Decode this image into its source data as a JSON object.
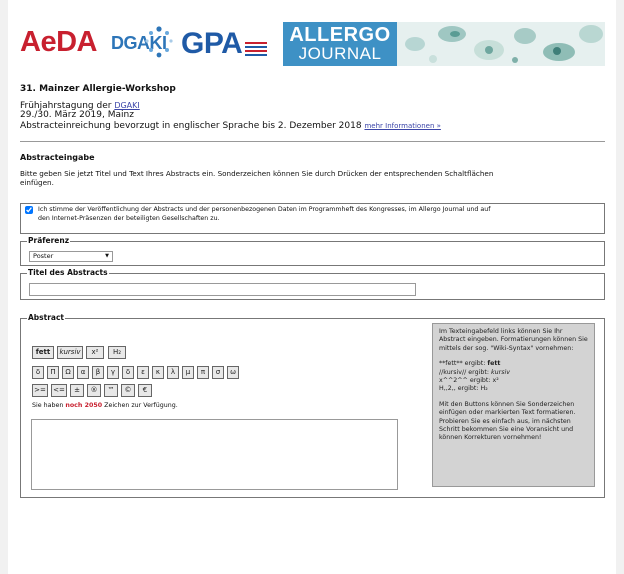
{
  "banner": {
    "aeda": "AeDA",
    "dgaki": "DGAKI",
    "gpa": "GPA",
    "allergo_line1": "ALLERGO",
    "allergo_line2": "JOURNAL"
  },
  "event": {
    "title": "31. Mainzer Allergie-Workshop",
    "line1_prefix": "Frühjahrstagung der",
    "line1_link": "DGAKI",
    "line2": "29./30. März 2019, Mainz",
    "line3": "Abstracteinreichung bevorzugt in englischer Sprache bis 2. Dezember 2018",
    "more_info_link": "mehr Informationen »"
  },
  "section": {
    "heading": "Abstracteingabe",
    "intro_line1": "Bitte geben Sie jetzt Titel und Text Ihres Abstracts ein. Sonderzeichen können Sie durch Drücken der entsprechenden Schaltflächen",
    "intro_line2": "einfügen."
  },
  "consent": {
    "checked": true,
    "line1": "Ich stimme der Veröffentlichung der Abstracts und der personenbezogenen Daten im Programmheft des Kongresses, im Allergo Journal und auf",
    "line2": "den Internet-Präsenzen der beteiligten Gesellschaften zu."
  },
  "preferenz": {
    "legend": "Präferenz",
    "selected": "Poster"
  },
  "titel": {
    "legend": "Titel des Abstracts",
    "value": ""
  },
  "abstract": {
    "legend": "Abstract",
    "format_buttons": [
      "fett",
      "kursiv",
      "x²",
      "H₂"
    ],
    "greek_buttons": [
      "δ",
      "Π",
      "Ω",
      "α",
      "β",
      "γ",
      "δ",
      "ε",
      "κ",
      "λ",
      "μ",
      "π",
      "σ",
      "ω"
    ],
    "symbol_buttons": [
      ">=",
      "<=",
      "±",
      "®",
      "™",
      "©",
      "€"
    ],
    "remaining_prefix": "Sie haben",
    "remaining_count": "noch 2050",
    "remaining_suffix": "Zeichen zur Verfügung.",
    "text_value": ""
  },
  "help": {
    "p1": "Im Texteingabefeld links können Sie Ihr Abstract eingeben. Formatierungen können Sie mittels der sog. \"Wiki-Syntax\" vornehmen:",
    "ex_bold_code": "**fett** ergibt:",
    "ex_bold_result": "fett",
    "ex_italic_code": "//kursiv// ergibt:",
    "ex_italic_result": "kursiv",
    "ex_sup_code": "x^^2^^ ergibt:",
    "ex_sup_result": "x²",
    "ex_sub_code": "H,,2,, ergibt:",
    "ex_sub_result": "H₂",
    "p2": "Mit den Buttons können Sie Sonderzeichen einfügen oder markierten Text formatieren. Probieren Sie es einfach aus, im nächsten Schritt bekommen Sie eine Voransicht und können Korrekturen vornehmen!"
  }
}
